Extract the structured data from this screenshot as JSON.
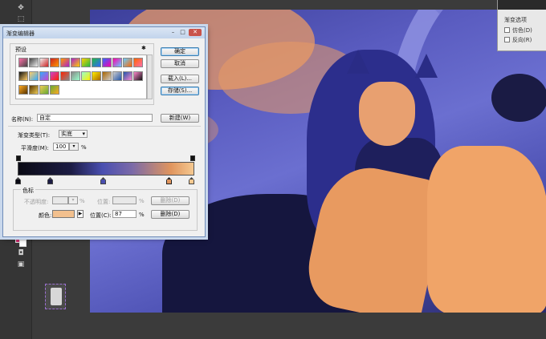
{
  "dialog": {
    "title": "渐变编辑器",
    "presets_label": "预设",
    "preset_colors": [
      [
        "#ff6fa8",
        "#444",
        "#f0f0f0",
        "#cc2222",
        "#ff9900",
        "#aa22cc",
        "#ffd000",
        "#22bb44",
        "#3366ff",
        "#ff00aa",
        "#66ccff",
        "#ff6600"
      ],
      [
        "#111",
        "#ffcc66",
        "#33aaff",
        "#cc44cc",
        "#ff2200",
        "#888",
        "#99ffcc",
        "#ffee00",
        "#aa6600",
        "#cccccc",
        "#2255aa",
        "#ff88cc"
      ],
      [
        "#ffaa22",
        "#553300",
        "#eecc55",
        "#66aa33"
      ]
    ],
    "buttons": {
      "ok": "确定",
      "cancel": "取消",
      "load": "载入(L)...",
      "save": "存储(S)...",
      "new": "新建(W)"
    },
    "name_label": "名称(N):",
    "name_value": "自定",
    "gradient_type_label": "渐变类型(T):",
    "gradient_type_value": "实底",
    "smoothness_label": "平滑度(M):",
    "smoothness_value": "100",
    "smoothness_unit": "%",
    "stops_group_label": "色标",
    "opacity_label": "不透明度:",
    "opacity_value": "",
    "opacity_unit": "%",
    "location_label_disabled": "位置:",
    "location_value_disabled": "",
    "location_unit_disabled": "%",
    "delete_label_disabled": "删除(D)",
    "color_label": "颜色:",
    "color_value": "#f2c08e",
    "location_label": "位置(C):",
    "location_value": "87",
    "location_unit": "%",
    "delete_label": "删除(D)",
    "gradient_stops": [
      {
        "color": "#0a0a14",
        "location": 0
      },
      {
        "color": "#1c1c44",
        "location": 18
      },
      {
        "color": "#4a4fb0",
        "location": 48
      },
      {
        "color": "#e0955e",
        "location": 87
      },
      {
        "color": "#f5c890",
        "location": 100
      }
    ]
  },
  "right_panel": {
    "title": "渐变选项",
    "dither_label": "仿色(D)",
    "reverse_label": "反向(R)"
  }
}
